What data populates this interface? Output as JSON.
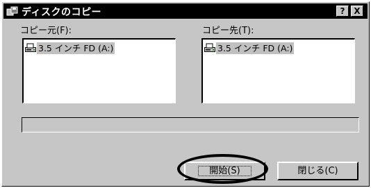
{
  "window": {
    "title": "ディスクのコピー",
    "help_label": "?",
    "close_label": "X"
  },
  "source": {
    "label": "コピー元(F):",
    "items": [
      {
        "label": "3.5 インチ FD (A:)",
        "icon": "floppy-drive-icon"
      }
    ]
  },
  "destination": {
    "label": "コピー先(T):",
    "items": [
      {
        "label": "3.5 インチ FD (A:)",
        "icon": "floppy-drive-icon"
      }
    ]
  },
  "progress": {
    "value": 0
  },
  "buttons": {
    "start_label": "開始(S)",
    "close_label": "閉じる(C)"
  },
  "colors": {
    "face": "#c6c6c6",
    "titlebar": "#000000",
    "selection": "#c0c0c0",
    "annotation": "#000000"
  }
}
